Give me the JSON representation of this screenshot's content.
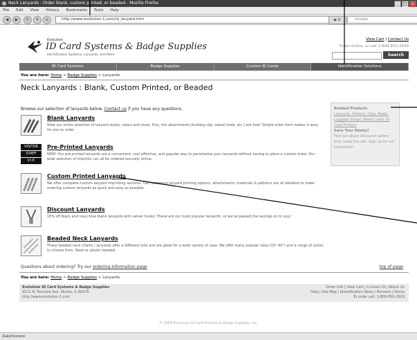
{
  "window": {
    "title": "Neck Lanyards : Order blank, custom printed, or beaded - Mozilla Firefox",
    "controls": [
      "_",
      "□",
      "x"
    ]
  },
  "menu": [
    "File",
    "Edit",
    "View",
    "History",
    "Bookmarks",
    "Tools",
    "Help"
  ],
  "toolbar": {
    "url": "http://www.evolution-1.com/id_lanyard.htm",
    "search_placeholder": "Google",
    "nav": [
      "◀",
      "▶",
      "↻",
      "✕",
      "⌂"
    ],
    "go": "▶ G"
  },
  "site": {
    "logo_small": "Evolution",
    "logo_big": "ID Card Systems & Badge Supplies",
    "logo_tag": "Identification Systems, Lanyards, and More",
    "top_links": {
      "cart": "View Cart",
      "sep": "|",
      "contact": "Contact Us"
    },
    "order": "Order online, or call 1-800-850-2929",
    "search_btn": "Search",
    "nav": [
      "ID Card Systems",
      "Badge Supplies",
      "Custom ID Cards",
      "Identification Solutions"
    ],
    "crumb": {
      "label": "You are here:",
      "home": "Home",
      "badge": "Badge Supplies",
      "current": "Lanyards",
      "sep": " > "
    },
    "title": "Neck Lanyards : Blank, Custom Printed, or Beaded",
    "intro": {
      "before": "Browse our selection of lanyards below. ",
      "link": "Contact us",
      "after": " if you have any questions."
    },
    "side": {
      "heading": "Related Products",
      "text1": "Lanyards, Holders, Clips, Reels, Luggage Straps, Blank Cards, ID Card Printers",
      "heading2": "Save Your Money!",
      "text2": "Find out about discounts before they make the site. Sign up for our newsletter!"
    },
    "products": [
      {
        "title": "Blank Lanyards",
        "desc": "View our entire selection of lanyard styles, colors and more. Plus, the attachments (bulldog clip, swivel hook, etc.) are free! Simple order form makes it easy for you to order."
      },
      {
        "title": "Pre-Printed Lanyards",
        "desc": "NEW! Our pre-printed lanyards are a convenient, cost effective, and popular way to personalize your lanyards without having to place a custom order. Our wide selection of imprints can all be ordered securely online."
      },
      {
        "title": "Custom Printed Lanyards",
        "desc": "We offer complete custom lanyard imprinting services. Our numerous lanyard printing options, attachments, materials & patterns are all detailed to make ordering custom lanyards as quick and easy as possible."
      },
      {
        "title": "Discount Lanyards",
        "desc": "15% off black and navy blue blank lanyards with swivel hooks! These are our most popular lanyards, so we've passed the savings on to you!"
      },
      {
        "title": "Beaded Neck Lanyards",
        "desc": "These beaded neck chains / lanyards offer a different look and are great for a wide variety of uses. We offer many popular sizes (15\"-40\") and a range of colors to choose from. Steel or plastic beaded."
      }
    ],
    "questions": {
      "before": "Questions about ordering? Try our ",
      "link": "ordering information page"
    },
    "top_of_page": "top of page",
    "footer": {
      "company": "Evolution ID Card Systems & Badge Supplies",
      "address": "9521 N. Fairview Ave. Skokie, IL 60076",
      "url": "http://www.evolution-1.com",
      "links1": "Order Info | View Cart | Contact Us | About Us",
      "links2": "Help | Site Map | Identification News | Partners | Home",
      "phone": "To order call: 1-800-850-2929"
    },
    "copyright": "© 2009 Evolution ID Card Printers & Badge Supplies, Inc."
  },
  "status": "Zakończono",
  "pre_printed_icon_text": [
    "VISITOR",
    "STAFF",
    "V.I.P."
  ]
}
